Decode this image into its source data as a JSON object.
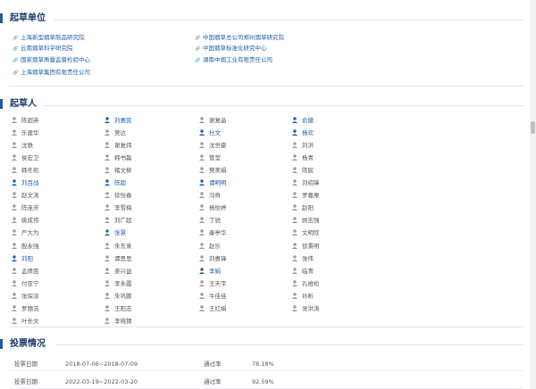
{
  "sections": {
    "units_title": "起草单位",
    "people_title": "起草人",
    "votes_title": "投票情况"
  },
  "units": [
    "上海新型烟草制品研究院",
    "中国烟草总公司郑州烟草研究院",
    "云南烟草科学研究院",
    "中国烟草标准化研究中心",
    "国家烟草质量监督检验中心",
    "湖南中烟工业有限责任公司",
    "上海烟草集团有限责任公司"
  ],
  "people": [
    [
      {
        "name": "陈超英",
        "linked": false
      },
      {
        "name": "刘惠民",
        "linked": true
      },
      {
        "name": "谢复晶",
        "linked": false
      },
      {
        "name": "俞健",
        "linked": true
      }
    ],
    [
      {
        "name": "乐建华",
        "linked": false
      },
      {
        "name": "吴达",
        "linked": false
      },
      {
        "name": "杜文",
        "linked": true
      },
      {
        "name": "杨欢",
        "linked": true
      }
    ],
    [
      {
        "name": "沈轶",
        "linked": false
      },
      {
        "name": "谢复炜",
        "linked": false
      },
      {
        "name": "沈世豪",
        "linked": false
      },
      {
        "name": "刘洪",
        "linked": false
      }
    ],
    [
      {
        "name": "侯宏卫",
        "linked": false
      },
      {
        "name": "韩书磊",
        "linked": false
      },
      {
        "name": "管莹",
        "linked": false
      },
      {
        "name": "杨青",
        "linked": false
      }
    ],
    [
      {
        "name": "韩冬凯",
        "linked": false
      },
      {
        "name": "褚文柳",
        "linked": false
      },
      {
        "name": "樊美娟",
        "linked": false
      },
      {
        "name": "陈宸",
        "linked": false
      }
    ],
    [
      {
        "name": "刘百战",
        "linked": true
      },
      {
        "name": "陈超",
        "linked": true
      },
      {
        "name": "谭明明",
        "linked": true
      },
      {
        "name": "刘绍锋",
        "linked": false
      }
    ],
    [
      {
        "name": "赵文涛",
        "linked": false
      },
      {
        "name": "徐怡春",
        "linked": false
      },
      {
        "name": "冯奇",
        "linked": false
      },
      {
        "name": "罗嘉栗",
        "linked": false
      }
    ],
    [
      {
        "name": "陈连芳",
        "linked": false
      },
      {
        "name": "李雪梅",
        "linked": false
      },
      {
        "name": "杨怡婷",
        "linked": false
      },
      {
        "name": "赵阳",
        "linked": false
      }
    ],
    [
      {
        "name": "姚成伟",
        "linked": false
      },
      {
        "name": "刘广超",
        "linked": false
      },
      {
        "name": "丁锐",
        "linked": false
      },
      {
        "name": "顾志强",
        "linked": false
      }
    ],
    [
      {
        "name": "严大为",
        "linked": false
      },
      {
        "name": "张慧",
        "linked": true
      },
      {
        "name": "秦亭华",
        "linked": false
      },
      {
        "name": "文明欣",
        "linked": false
      }
    ],
    [
      {
        "name": "殷永强",
        "linked": false
      },
      {
        "name": "朱东来",
        "linked": false
      },
      {
        "name": "赵乐",
        "linked": false
      },
      {
        "name": "徐秉明",
        "linked": false
      }
    ],
    [
      {
        "name": "刘阳",
        "linked": true
      },
      {
        "name": "谭思思",
        "linked": false
      },
      {
        "name": "刘惠锋",
        "linked": false
      },
      {
        "name": "张伟",
        "linked": false
      }
    ],
    [
      {
        "name": "孟倩亩",
        "linked": false
      },
      {
        "name": "姜兴益",
        "linked": false
      },
      {
        "name": "李娟",
        "linked": true
      },
      {
        "name": "临青",
        "linked": false
      }
    ],
    [
      {
        "name": "付亚宁",
        "linked": false
      },
      {
        "name": "李永霞",
        "linked": false
      },
      {
        "name": "王天宇",
        "linked": false
      },
      {
        "name": "孔维松",
        "linked": false
      }
    ],
    [
      {
        "name": "张琛淳",
        "linked": false
      },
      {
        "name": "朱巩鹏",
        "linked": false
      },
      {
        "name": "牛佳佳",
        "linked": false
      },
      {
        "name": "孙昕",
        "linked": false
      }
    ],
    [
      {
        "name": "罗丽洁",
        "linked": false
      },
      {
        "name": "王阳志",
        "linked": false
      },
      {
        "name": "王红娟",
        "linked": false
      },
      {
        "name": "张洪涛",
        "linked": false
      }
    ],
    [
      {
        "name": "叶长文",
        "linked": false
      },
      {
        "name": "李晓猜",
        "linked": false
      }
    ]
  ],
  "votes": {
    "date_label": "投票日期",
    "rate_label": "通过率",
    "rows": [
      {
        "date": "2018-07-06~2018-07-09",
        "rate": "78.18%"
      },
      {
        "date": "2022-03-19~2022-03-20",
        "rate": "92.59%"
      }
    ]
  },
  "colors": {
    "title": "#1a3a6b",
    "accent": "#1a5ca8",
    "link": "#1f5fa8",
    "text": "#555555"
  }
}
